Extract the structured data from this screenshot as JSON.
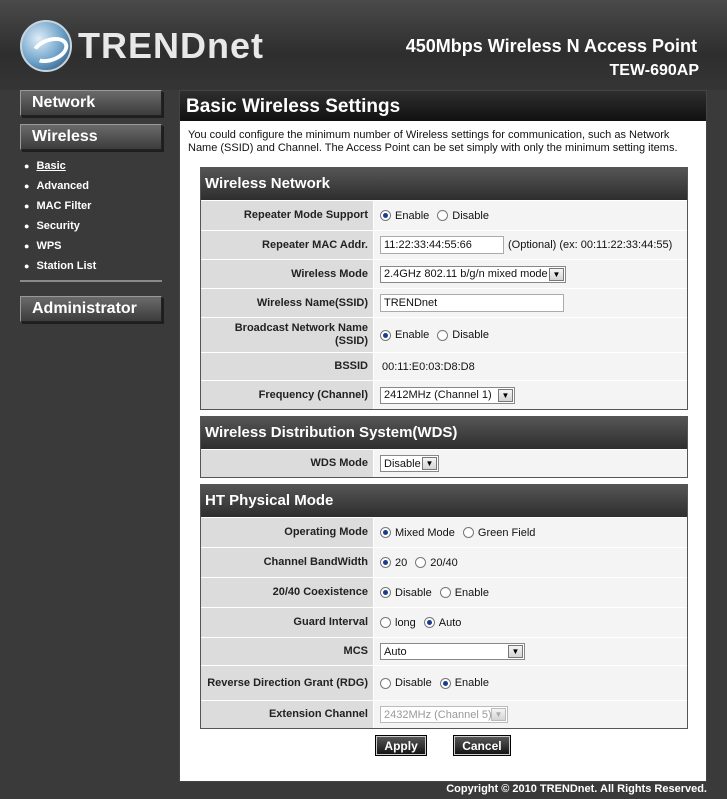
{
  "header": {
    "logo": "TRENDnet",
    "product": "450Mbps Wireless N Access Point",
    "model": "TEW-690AP"
  },
  "sidebar": {
    "network": "Network",
    "wireless": "Wireless",
    "items": [
      {
        "label": "Basic"
      },
      {
        "label": "Advanced"
      },
      {
        "label": "MAC Filter"
      },
      {
        "label": "Security"
      },
      {
        "label": "WPS"
      },
      {
        "label": "Station List"
      }
    ],
    "administrator": "Administrator"
  },
  "main": {
    "title": "Basic Wireless Settings",
    "intro": "You could configure the minimum number of Wireless settings for communication, such as Network Name (SSID) and Channel. The Access Point can be set simply with only the minimum setting items."
  },
  "wireless_network": {
    "title": "Wireless Network",
    "repeater_mode_label": "Repeater Mode Support",
    "repeater_enable": "Enable",
    "repeater_disable": "Disable",
    "repeater_mac_label": "Repeater MAC Addr.",
    "repeater_mac_value": "11:22:33:44:55:66",
    "repeater_mac_hint": "(Optional) (ex: 00:11:22:33:44:55)",
    "wireless_mode_label": "Wireless Mode",
    "wireless_mode_value": "2.4GHz 802.11 b/g/n mixed mode",
    "ssid_label": "Wireless Name(SSID)",
    "ssid_value": "TRENDnet",
    "broadcast_label": "Broadcast Network Name (SSID)",
    "broadcast_enable": "Enable",
    "broadcast_disable": "Disable",
    "bssid_label": "BSSID",
    "bssid_value": "00:11:E0:03:D8:D8",
    "frequency_label": "Frequency (Channel)",
    "frequency_value": "2412MHz (Channel 1)"
  },
  "wds": {
    "title": "Wireless Distribution System(WDS)",
    "mode_label": "WDS Mode",
    "mode_value": "Disable"
  },
  "ht": {
    "title": "HT Physical Mode",
    "op_mode_label": "Operating Mode",
    "op_mixed": "Mixed Mode",
    "op_green": "Green Field",
    "bw_label": "Channel BandWidth",
    "bw_20": "20",
    "bw_2040": "20/40",
    "coex_label": "20/40 Coexistence",
    "coex_disable": "Disable",
    "coex_enable": "Enable",
    "gi_label": "Guard Interval",
    "gi_long": "long",
    "gi_auto": "Auto",
    "mcs_label": "MCS",
    "mcs_value": "Auto",
    "rdg_label": "Reverse Direction Grant (RDG)",
    "rdg_disable": "Disable",
    "rdg_enable": "Enable",
    "ext_label": "Extension Channel",
    "ext_value": "2432MHz (Channel 5)"
  },
  "buttons": {
    "apply": "Apply",
    "cancel": "Cancel"
  },
  "footer": "Copyright © 2010 TRENDnet. All Rights Reserved."
}
